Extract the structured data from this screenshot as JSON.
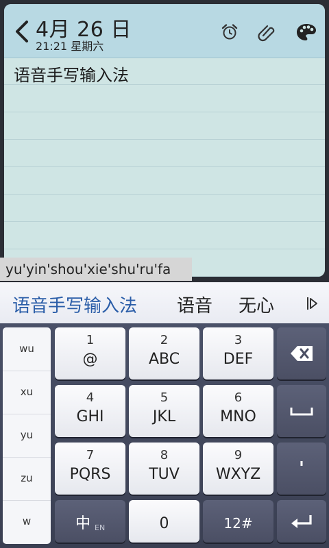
{
  "note": {
    "date_main": "4月 26 日",
    "date_sub": "21:21 星期六",
    "body_text": "语音手写输入法"
  },
  "composing": {
    "text": "yu'yin'shou'xie'shu'ru'fa"
  },
  "candidates": [
    "语音手写输入法",
    "语音",
    "无心"
  ],
  "pinyin_options": [
    "wu",
    "xu",
    "yu",
    "zu",
    "w"
  ],
  "keys": {
    "k1": {
      "num": "1",
      "label": "@"
    },
    "k2": {
      "num": "2",
      "label": "ABC"
    },
    "k3": {
      "num": "3",
      "label": "DEF"
    },
    "k4": {
      "num": "4",
      "label": "GHI"
    },
    "k5": {
      "num": "5",
      "label": "JKL"
    },
    "k6": {
      "num": "6",
      "label": "MNO"
    },
    "k7": {
      "num": "7",
      "label": "PQRS"
    },
    "k8": {
      "num": "8",
      "label": "TUV"
    },
    "k9": {
      "num": "9",
      "label": "WXYZ"
    },
    "k0": {
      "label": "0"
    },
    "lang": {
      "label": "中",
      "sub": "EN"
    },
    "sym": {
      "label": "12#"
    },
    "apostrophe": {
      "label": "'"
    }
  },
  "colors": {
    "accent_blue": "#2a5da8",
    "note_bg": "#cfe5e4",
    "header_bg": "#b8d9e3",
    "keyboard_bg": "#3a3f52"
  },
  "icons": [
    "back-arrow-icon",
    "alarm-icon",
    "paperclip-icon",
    "palette-icon",
    "candidate-more-icon",
    "backspace-icon",
    "space-icon",
    "enter-icon"
  ]
}
